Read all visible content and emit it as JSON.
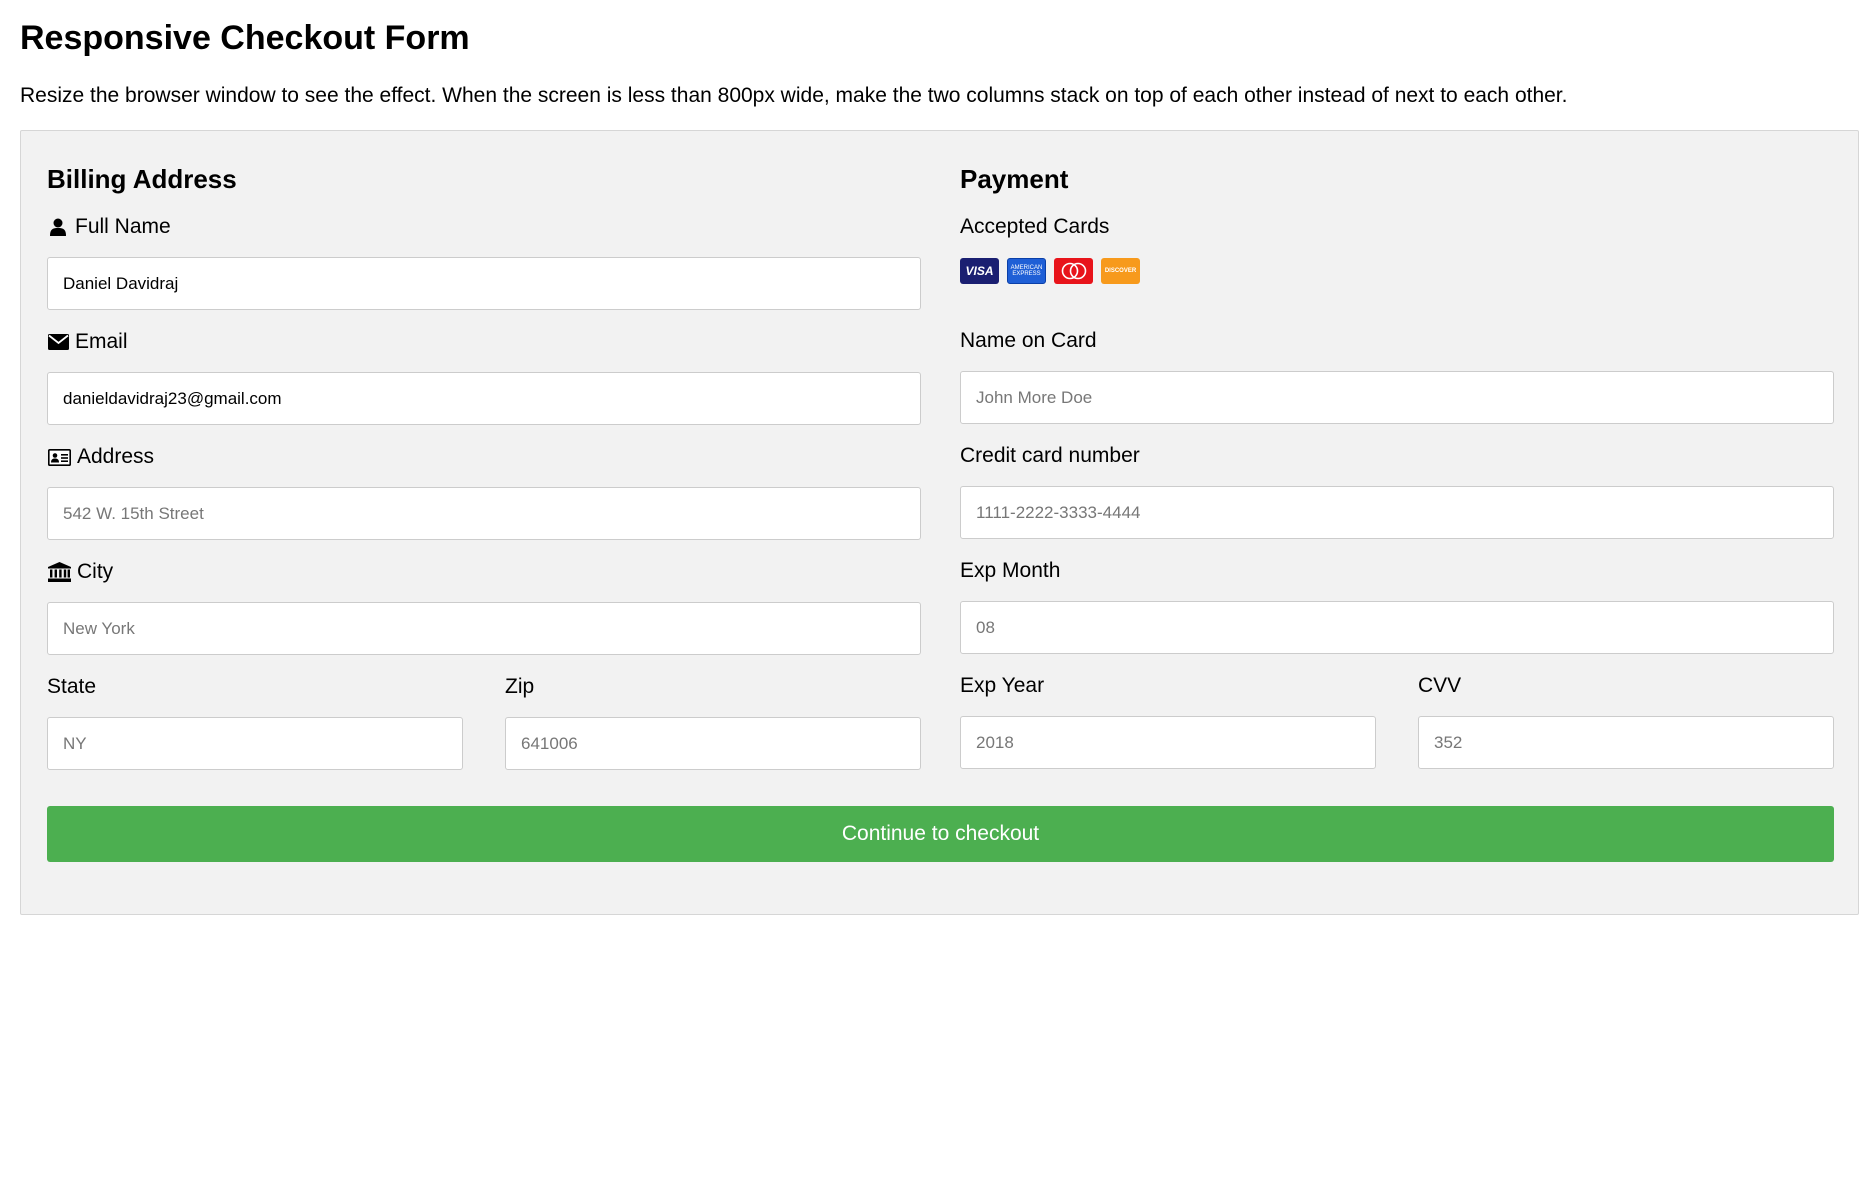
{
  "page": {
    "title": "Responsive Checkout Form",
    "description": "Resize the browser window to see the effect. When the screen is less than 800px wide, make the two columns stack on top of each other instead of next to each other."
  },
  "billing": {
    "title": "Billing Address",
    "full_name": {
      "label": "Full Name",
      "icon": "user-icon",
      "value": "Daniel Davidraj",
      "placeholder": ""
    },
    "email": {
      "label": "Email",
      "icon": "envelope-icon",
      "value": "danieldavidraj23@gmail.com",
      "placeholder": ""
    },
    "address": {
      "label": "Address",
      "icon": "address-card-icon",
      "value": "",
      "placeholder": "542 W. 15th Street"
    },
    "city": {
      "label": "City",
      "icon": "institution-icon",
      "value": "",
      "placeholder": "New York"
    },
    "state": {
      "label": "State",
      "value": "",
      "placeholder": "NY"
    },
    "zip": {
      "label": "Zip",
      "value": "",
      "placeholder": "641006"
    }
  },
  "payment": {
    "title": "Payment",
    "accepted_cards_label": "Accepted Cards",
    "cards": {
      "visa": {
        "text": "VISA",
        "color": "#1a1f71"
      },
      "amex": {
        "text": "AMERICAN EXPRESS",
        "color": "#1f5fd6"
      },
      "mastercard": {
        "color": "#e8141b"
      },
      "discover": {
        "text": "DISCOVER",
        "color": "#f79a1c"
      }
    },
    "name_on_card": {
      "label": "Name on Card",
      "value": "",
      "placeholder": "John More Doe"
    },
    "card_number": {
      "label": "Credit card number",
      "value": "",
      "placeholder": "1111-2222-3333-4444"
    },
    "exp_month": {
      "label": "Exp Month",
      "value": "",
      "placeholder": "08"
    },
    "exp_year": {
      "label": "Exp Year",
      "value": "",
      "placeholder": "2018"
    },
    "cvv": {
      "label": "CVV",
      "value": "",
      "placeholder": "352"
    }
  },
  "submit": {
    "label": "Continue to checkout",
    "color": "#4caf50"
  }
}
